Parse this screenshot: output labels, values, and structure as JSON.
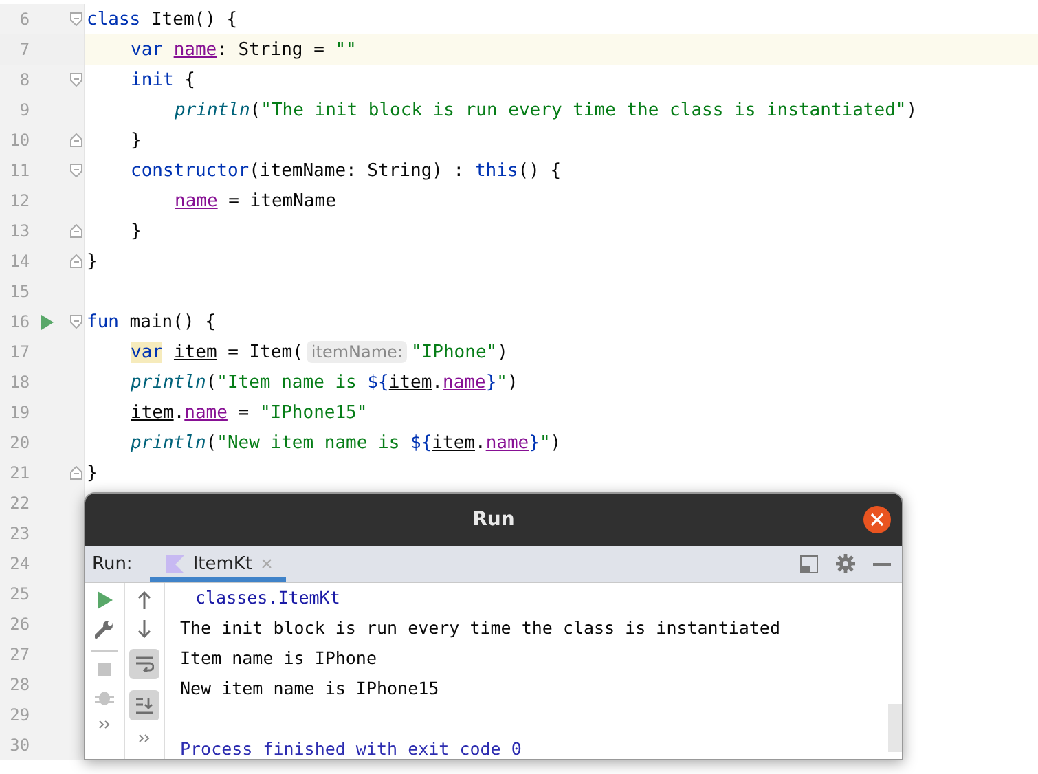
{
  "editor": {
    "lines": [
      {
        "number": "6",
        "current": false,
        "gutter_icons": [
          {
            "kind": "fold-start"
          }
        ],
        "tokens": [
          {
            "kind": "kw",
            "text": "class"
          },
          {
            "kind": "text",
            "text": " Item() {"
          }
        ],
        "children": [
          {
            "number": "7",
            "current": true,
            "tokens": [
              {
                "kind": "kw",
                "text": "var "
              },
              {
                "kind": "field",
                "text": "name"
              },
              {
                "kind": "text",
                "text": ": String = "
              },
              {
                "kind": "str",
                "text": "\"\""
              }
            ]
          },
          {
            "number": "8",
            "current": false,
            "gutter_icons": [
              {
                "kind": "fold-start"
              }
            ],
            "tokens": [
              {
                "kind": "kw",
                "text": "init"
              },
              {
                "kind": "text",
                "text": " {"
              }
            ],
            "children": [
              {
                "number": "9",
                "current": false,
                "tokens": [
                  {
                    "kind": "fn",
                    "text": "println"
                  },
                  {
                    "kind": "text",
                    "text": "("
                  },
                  {
                    "kind": "str",
                    "text": "\"The init block is run every time the class is instantiated\""
                  },
                  {
                    "kind": "text",
                    "text": ")"
                  }
                ]
              }
            ]
          },
          {
            "number": "10",
            "current": false,
            "gutter_icons": [
              {
                "kind": "fold-end"
              }
            ],
            "tokens": [
              {
                "kind": "text",
                "text": "}"
              }
            ]
          },
          {
            "number": "11",
            "current": false,
            "gutter_icons": [
              {
                "kind": "fold-start"
              }
            ],
            "tokens": [
              {
                "kind": "kw",
                "text": "constructor"
              },
              {
                "kind": "text",
                "text": "(itemName: String) : "
              },
              {
                "kind": "kw",
                "text": "this"
              },
              {
                "kind": "text",
                "text": "() {"
              }
            ],
            "children": [
              {
                "number": "12",
                "current": false,
                "tokens": [
                  {
                    "kind": "field",
                    "text": "name"
                  },
                  {
                    "kind": "text",
                    "text": " = itemName"
                  }
                ]
              }
            ]
          },
          {
            "number": "13",
            "current": false,
            "gutter_icons": [
              {
                "kind": "fold-end"
              }
            ],
            "tokens": [
              {
                "kind": "text",
                "text": "}"
              }
            ]
          }
        ]
      },
      {
        "number": "14",
        "current": false,
        "gutter_icons": [
          {
            "kind": "fold-end"
          }
        ],
        "tokens": [
          {
            "kind": "text",
            "text": "}"
          }
        ]
      },
      {
        "number": "15",
        "current": false
      },
      {
        "number": "16",
        "current": false,
        "gutter_icons": [
          {
            "kind": "run"
          },
          {
            "kind": "fold-start"
          }
        ],
        "tokens": [
          {
            "kind": "kw",
            "text": "fun"
          },
          {
            "kind": "text",
            "text": " main() {"
          }
        ],
        "children": [
          {
            "number": "17",
            "current": false,
            "tokens": [
              {
                "kind": "kw-marked",
                "text": "var"
              },
              {
                "kind": "spaced-ref",
                "text": "item"
              },
              {
                "kind": "text",
                "text": " = Item("
              },
              {
                "kind": "hint",
                "text": "itemName:"
              },
              {
                "kind": "str",
                "text": "\"IPhone\""
              },
              {
                "kind": "text",
                "text": ")"
              }
            ]
          },
          {
            "number": "18",
            "current": false,
            "tokens": [
              {
                "kind": "fn",
                "text": "println"
              },
              {
                "kind": "text",
                "text": "("
              },
              {
                "kind": "str",
                "text": "\"Item name is "
              },
              {
                "kind": "kw",
                "text": "${"
              },
              {
                "kind": "ref",
                "text": "item"
              },
              {
                "kind": "text",
                "text": "."
              },
              {
                "kind": "field",
                "text": "name"
              },
              {
                "kind": "kw",
                "text": "}"
              },
              {
                "kind": "str",
                "text": "\""
              },
              {
                "kind": "text",
                "text": ")"
              }
            ]
          },
          {
            "number": "19",
            "current": false,
            "tokens": [
              {
                "kind": "ref",
                "text": "item"
              },
              {
                "kind": "text",
                "text": "."
              },
              {
                "kind": "field",
                "text": "name"
              },
              {
                "kind": "text",
                "text": " = "
              },
              {
                "kind": "str",
                "text": "\"IPhone15\""
              }
            ]
          },
          {
            "number": "20",
            "current": false,
            "tokens": [
              {
                "kind": "fn",
                "text": "println"
              },
              {
                "kind": "text",
                "text": "("
              },
              {
                "kind": "str",
                "text": "\"New item name is "
              },
              {
                "kind": "kw",
                "text": "${"
              },
              {
                "kind": "ref",
                "text": "item"
              },
              {
                "kind": "text",
                "text": "."
              },
              {
                "kind": "field",
                "text": "name"
              },
              {
                "kind": "kw",
                "text": "}"
              },
              {
                "kind": "str",
                "text": "\""
              },
              {
                "kind": "text",
                "text": ")"
              }
            ]
          }
        ]
      },
      {
        "number": "21",
        "current": false,
        "gutter_icons": [
          {
            "kind": "fold-end"
          }
        ],
        "tokens": [
          {
            "kind": "text",
            "text": "}"
          }
        ]
      },
      {
        "number": "22",
        "current": false
      },
      {
        "number": "23",
        "current": false
      },
      {
        "number": "24",
        "current": false
      },
      {
        "number": "25",
        "current": false
      },
      {
        "number": "26",
        "current": false
      },
      {
        "number": "27",
        "current": false
      },
      {
        "number": "28",
        "current": false
      },
      {
        "number": "29",
        "current": false
      },
      {
        "number": "30",
        "current": false
      }
    ]
  },
  "run_window": {
    "title": "Run",
    "label": "Run:",
    "tabs": [
      {
        "label": "ItemKt",
        "selected": true
      }
    ],
    "toggles": [
      {
        "kind": "wrap",
        "on": true
      },
      {
        "kind": "scroll-end",
        "on": true
      }
    ],
    "console": [
      {
        "kind": "path",
        "text": "classes.ItemKt"
      },
      {
        "kind": "out",
        "text": "The init block is run every time the class is instantiated"
      },
      {
        "kind": "out",
        "text": "Item name is IPhone"
      },
      {
        "kind": "out",
        "text": "New item name is IPhone15"
      }
    ],
    "exit_message": "Process finished with exit code 0"
  }
}
